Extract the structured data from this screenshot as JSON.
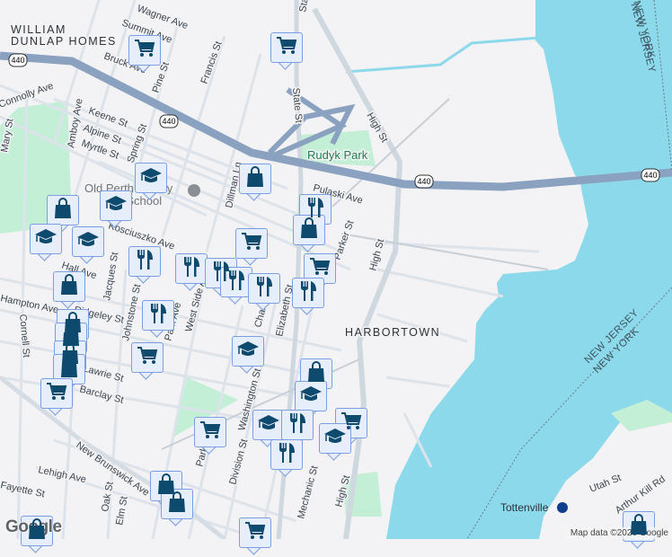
{
  "map": {
    "neighborhoods": [
      "WILLIAM",
      "DUNLAP HOMES",
      "HARBORTOWN"
    ],
    "parks": [
      "Rudyk Park"
    ],
    "poi": [
      "Old Perth Amboy",
      "High School"
    ],
    "state_borders": [
      "NEW YORK",
      "NEW JERSEY",
      "NEW JERSEY",
      "NEW YORK"
    ],
    "station": "Tottenville",
    "highway_shield": "440",
    "streets": [
      "Wagner Ave",
      "Summit Ave",
      "Bruck Ave",
      "Pine St",
      "Francis St",
      "State St",
      "State St",
      "High St",
      "High St",
      "Keene St",
      "Alpine St",
      "Myrtle St",
      "Spring St",
      "Amboy Ave",
      "Connolly Ave",
      "Mary St",
      "Dillman Ln",
      "Pulaski Ave",
      "Parker St",
      "Kosciuszko Ave",
      "Hall Ave",
      "Jacques St",
      "Johnstone St",
      "West Side Ave",
      "Charles St",
      "Elizabeth St",
      "Hampton Ave",
      "Ridgeley St",
      "Cornell St",
      "Barclay St",
      "Lawrie St",
      "New Brunswick Ave",
      "Lehigh Ave",
      "Fayette St",
      "Oak St",
      "Elm St",
      "Division St",
      "Mechanic St",
      "High St",
      "Utah St",
      "Arthur Kill Rd",
      "Park Ave",
      "Park Ave",
      "Washington St"
    ],
    "markers": [
      "cart",
      "cart",
      "school",
      "school",
      "bag",
      "bag",
      "food",
      "bag",
      "school",
      "school",
      "cart",
      "food",
      "food",
      "food",
      "food",
      "food",
      "cart",
      "food",
      "bag",
      "food",
      "bag",
      "bag",
      "bag",
      "bag",
      "cart",
      "cart",
      "school",
      "bag",
      "school",
      "school",
      "food",
      "food",
      "cart",
      "school",
      "cart",
      "bag",
      "bag",
      "cart",
      "bag",
      "bag"
    ]
  },
  "footer": {
    "google": "Google",
    "attribution": "Map data ©2026 Google"
  },
  "colors": {
    "water": "#8cd9ec",
    "land": "#f3f2f4",
    "park": "#c2efd6",
    "highway": "#8aa2c0",
    "marker": "#0d4a6e"
  }
}
